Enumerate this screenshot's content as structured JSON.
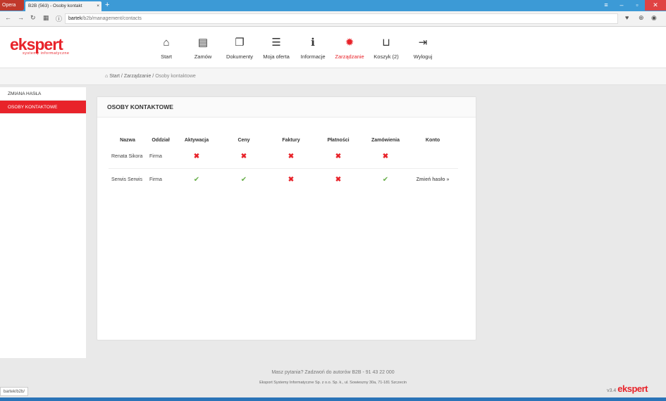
{
  "browser": {
    "opera_label": "Opera",
    "tab_title": "B2B (563) - Osoby kontakt",
    "url_host": "bartek",
    "url_path": "/b2b/management/contacts",
    "status_url": "bartek/b2b/"
  },
  "logo": {
    "main": "ekspert",
    "sub": "systemy informatyczne"
  },
  "menu": [
    {
      "label": "Start",
      "icon": "home-icon",
      "glyph": "⌂"
    },
    {
      "label": "Zamów",
      "icon": "order-icon",
      "glyph": "▤"
    },
    {
      "label": "Dokumenty",
      "icon": "documents-icon",
      "glyph": "❐"
    },
    {
      "label": "Moja oferta",
      "icon": "list-icon",
      "glyph": "☰"
    },
    {
      "label": "Informacje",
      "icon": "info-icon",
      "glyph": "ℹ"
    },
    {
      "label": "Zarządzanie",
      "icon": "gear-icon",
      "glyph": "✹"
    },
    {
      "label": "Koszyk (2)",
      "icon": "cart-icon",
      "glyph": "⊔"
    },
    {
      "label": "Wyloguj",
      "icon": "logout-icon",
      "glyph": "⇥"
    }
  ],
  "breadcrumb": {
    "start": "Start",
    "sep1": " / ",
    "manage": "Zarządzanie",
    "sep2": " / ",
    "current": "Osoby kontaktowe"
  },
  "sidebar": {
    "items": [
      {
        "label": "Zmiana hasła"
      },
      {
        "label": "Osoby kontaktowe"
      }
    ]
  },
  "panel": {
    "title": "Osoby kontaktowe",
    "columns": [
      "Nazwa",
      "Oddział",
      "Aktywacja",
      "Ceny",
      "Faktury",
      "Płatności",
      "Zamówienia",
      "Konto"
    ],
    "rows": [
      {
        "name": "Renata Sikora",
        "branch": "Firma",
        "flags": [
          false,
          false,
          false,
          false,
          false
        ],
        "account": ""
      },
      {
        "name": "Serwis Serwis",
        "branch": "Firma",
        "flags": [
          true,
          true,
          false,
          false,
          true
        ],
        "account": "Zmień hasło »"
      }
    ]
  },
  "footer": {
    "question": "Masz pytania? Zadzwoń do autorów B2B - 91 43 22 000",
    "company": "Eksport Systemy Informatyczne Sp. z o.o. Sp. k., ul. Sowieszny 30a, 71-181 Szczecin",
    "version": "v3.4",
    "brand": "ekspert"
  },
  "colors": {
    "accent": "#e8232a",
    "ok": "#6ab04c"
  }
}
